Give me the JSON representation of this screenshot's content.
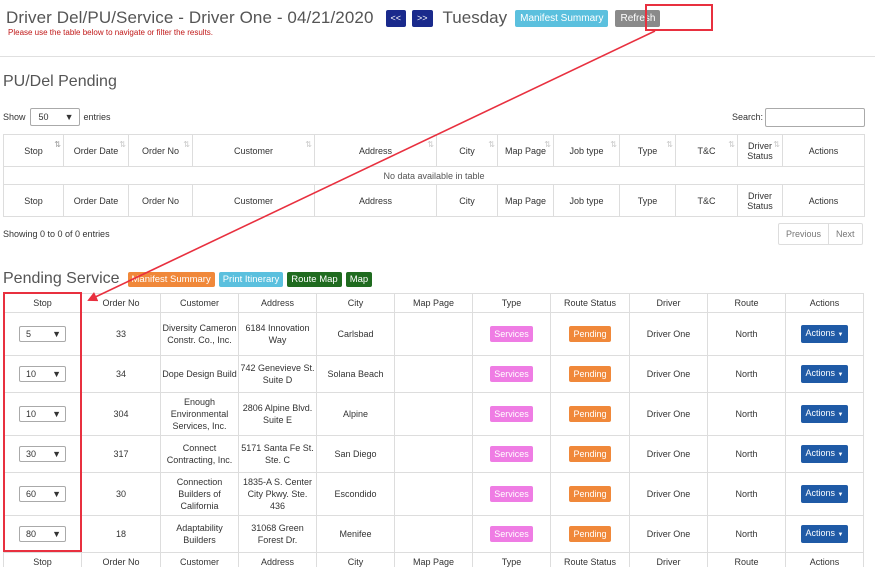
{
  "header": {
    "title": "Driver Del/PU/Service - Driver One - 04/21/2020",
    "prev_label": "<<",
    "next_label": ">>",
    "day": "Tuesday",
    "manifest_label": "Manifest Summary",
    "refresh_label": "Refresh",
    "instruction": "Please use the table below to navigate or filter the results."
  },
  "pudel": {
    "title": "PU/Del Pending",
    "show_label": "Show",
    "entries_value": "50",
    "entries_label": "entries",
    "search_label": "Search:",
    "search_value": "",
    "columns": [
      "Stop",
      "Order Date",
      "Order No",
      "Customer",
      "Address",
      "City",
      "Map Page",
      "Job type",
      "Type",
      "T&C",
      "Driver Status",
      "Actions"
    ],
    "empty_text": "No data available in table",
    "info": "Showing 0 to 0 of 0 entries",
    "previous_label": "Previous",
    "next_label": "Next"
  },
  "pending_service": {
    "title": "Pending Service",
    "buttons": {
      "manifest": "Manifest Summary",
      "itinerary": "Print Itinerary",
      "route_map": "Route Map",
      "map": "Map"
    },
    "columns": [
      "Stop",
      "Order No",
      "Customer",
      "Address",
      "City",
      "Map Page",
      "Type",
      "Route Status",
      "Driver",
      "Route",
      "Actions"
    ],
    "rows": [
      {
        "stop": "5",
        "order_no": "33",
        "customer": "Diversity Cameron Constr. Co., Inc.",
        "address": "6184 Innovation Way",
        "city": "Carlsbad",
        "map_page": "",
        "type": "Services",
        "status": "Pending",
        "driver": "Driver One",
        "route": "North",
        "actions": "Actions"
      },
      {
        "stop": "10",
        "order_no": "34",
        "customer": "Dope Design Build",
        "address": "742 Genevieve St. Suite D",
        "city": "Solana Beach",
        "map_page": "",
        "type": "Services",
        "status": "Pending",
        "driver": "Driver One",
        "route": "North",
        "actions": "Actions"
      },
      {
        "stop": "10",
        "order_no": "304",
        "customer": "Enough Environmental Services, Inc.",
        "address": "2806 Alpine Blvd. Suite E",
        "city": "Alpine",
        "map_page": "",
        "type": "Services",
        "status": "Pending",
        "driver": "Driver One",
        "route": "North",
        "actions": "Actions"
      },
      {
        "stop": "30",
        "order_no": "317",
        "customer": "Connect Contracting, Inc.",
        "address": "5171 Santa Fe St. Ste. C",
        "city": "San Diego",
        "map_page": "",
        "type": "Services",
        "status": "Pending",
        "driver": "Driver One",
        "route": "North",
        "actions": "Actions"
      },
      {
        "stop": "60",
        "order_no": "30",
        "customer": "Connection Builders of California",
        "address": "1835-A S. Center City Pkwy. Ste. 436",
        "city": "Escondido",
        "map_page": "",
        "type": "Services",
        "status": "Pending",
        "driver": "Driver One",
        "route": "North",
        "actions": "Actions"
      },
      {
        "stop": "80",
        "order_no": "18",
        "customer": "Adaptability Builders",
        "address": "31068 Green Forest Dr.",
        "city": "Menifee",
        "map_page": "",
        "type": "Services",
        "status": "Pending",
        "driver": "Driver One",
        "route": "North",
        "actions": "Actions"
      }
    ]
  },
  "colors": {
    "nav": "#1a2a8c",
    "info": "#5bc0de",
    "refresh": "#8a8a8a",
    "orange": "#f0883a",
    "green": "#1f6b1f",
    "services": "#ef7ce4",
    "actions": "#1f5aa6",
    "annotation": "#e8303f",
    "instruction": "#c01818"
  }
}
